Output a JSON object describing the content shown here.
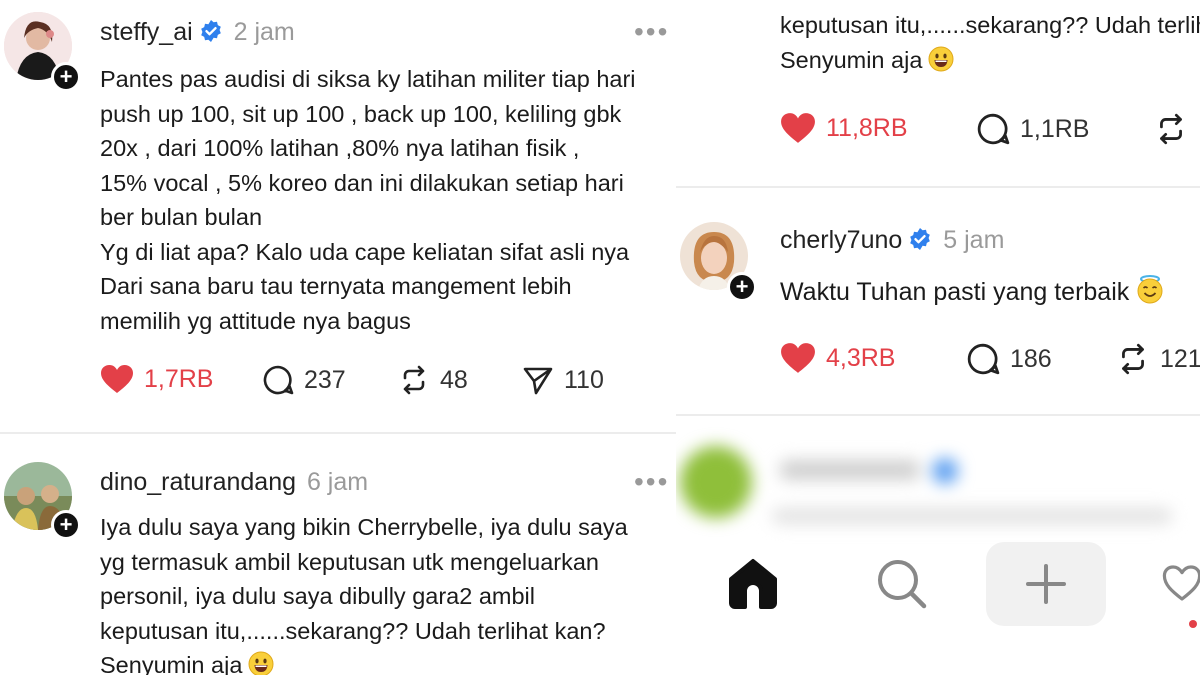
{
  "colors": {
    "like": "#e34048",
    "verified": "#2f80ed",
    "separator": "#ececec",
    "muted": "#9a9a9a"
  },
  "left": {
    "posts": [
      {
        "username": "steffy_ai",
        "verified": true,
        "time": "2 jam",
        "more": "•••",
        "lines": [
          "Pantes pas audisi di siksa ky latihan militer tiap hari",
          "push up 100, sit up 100 , back up 100, keliling gbk",
          "20x , dari 100% latihan ,80% nya latihan fisik ,",
          "15% vocal , 5% koreo dan ini dilakukan setiap hari",
          "ber bulan bulan",
          "Yg di liat apa? Kalo uda cape keliatan sifat asli nya",
          "Dari sana baru tau ternyata mangement lebih",
          "memilih yg attitude nya bagus"
        ],
        "likes": "1,7RB",
        "replies": "237",
        "reposts": "48",
        "shares": "110"
      },
      {
        "username": "dino_raturandang",
        "verified": false,
        "time": "6 jam",
        "more": "•••",
        "lines": [
          "Iya dulu saya yang bikin Cherrybelle, iya dulu saya",
          "yg termasuk ambil keputusan utk mengeluarkan",
          "personil, iya dulu saya dibully gara2 ambil",
          "keputusan itu,......sekarang?? Udah terlihat kan?",
          "Senyumin aja"
        ],
        "emoji": "grinning-face"
      }
    ]
  },
  "right": {
    "top_post": {
      "lines": [
        "keputusan itu,......sekarang?? Udah terlihat kan?",
        "Senyumin aja"
      ],
      "emoji": "grinning-face",
      "likes": "11,8RB",
      "replies": "1,1RB"
    },
    "second_post": {
      "username": "cherly7uno",
      "verified": true,
      "time": "5 jam",
      "text": "Waktu Tuhan pasti yang terbaik",
      "emoji": "smiling-face-with-halo",
      "likes": "4,3RB",
      "replies": "186",
      "reposts": "121"
    },
    "nav": [
      "home-icon",
      "search-icon",
      "plus-icon",
      "heart-icon"
    ]
  }
}
